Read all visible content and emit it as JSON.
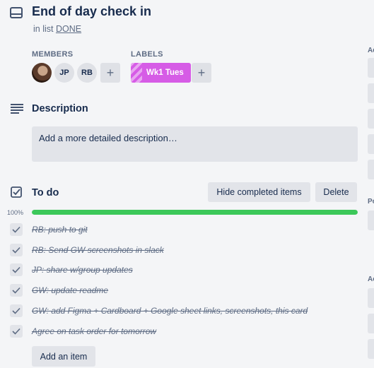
{
  "card": {
    "title": "End of day check in",
    "in_list_prefix": "in list",
    "list_name": "DONE"
  },
  "members": {
    "label": "MEMBERS",
    "avatars": [
      "JP",
      "RB"
    ],
    "add_symbol": "+"
  },
  "labels": {
    "label": "LABELS",
    "chips": [
      {
        "text": "Wk1 Tues",
        "color": "#d65ce6"
      }
    ],
    "add_symbol": "+"
  },
  "description": {
    "title": "Description",
    "placeholder": "Add a more detailed description…"
  },
  "checklist": {
    "title": "To do",
    "hide_completed_label": "Hide completed items",
    "delete_label": "Delete",
    "progress_text": "100%",
    "progress": 1.0,
    "progress_color": "#3cc85a",
    "items": [
      "RB: push to git",
      "RB: Send GW screenshots in slack",
      "JP: share w/group updates",
      "GW: update readme",
      "GW: add Figma + Cardboard + Google sheet links, screenshots, this card",
      "Agree on task order for tomorrow"
    ],
    "add_item_label": "Add an item"
  },
  "sidebar": {
    "headings": [
      "Ad",
      "Po",
      "Ac"
    ]
  }
}
